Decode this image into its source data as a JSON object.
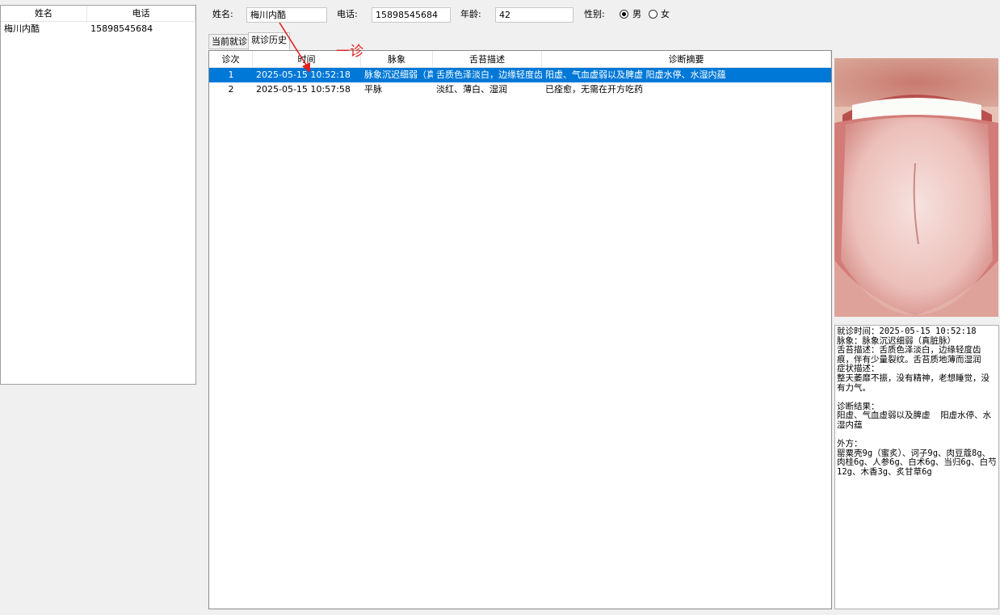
{
  "patient_list": {
    "headers": [
      "姓名",
      "电话"
    ],
    "rows": [
      {
        "name": "梅川内酷",
        "phone": "15898545684"
      }
    ]
  },
  "form": {
    "name_label": "姓名:",
    "name_value": "梅川内酷",
    "phone_label": "电话:",
    "phone_value": "15898545684",
    "age_label": "年龄:",
    "age_value": "42",
    "gender_label": "性别:",
    "gender_male": "男",
    "gender_female": "女",
    "gender_selected": "男"
  },
  "tabs": {
    "current": "当前就诊",
    "history": "就诊历史",
    "active": "history"
  },
  "grid": {
    "headers": [
      "诊次",
      "时间",
      "脉象",
      "舌苔描述",
      "诊断摘要"
    ],
    "rows": [
      {
        "no": "1",
        "time": "2025-05-15 10:52:18",
        "pulse": "脉象沉迟细弱（真",
        "tongue": "舌质色泽淡白，边缘轻度齿",
        "summary": "阳虚、气血虚弱以及脾虚  阳虚水停、水湿内蕴",
        "selected": true
      },
      {
        "no": "2",
        "time": "2025-05-15 10:57:58",
        "pulse": "平脉",
        "tongue": "淡红、薄白、湿润",
        "summary": "已痊愈，无需在开方吃药",
        "selected": false
      }
    ]
  },
  "annotation": {
    "text": "一诊",
    "color": "#e02020"
  },
  "notes": {
    "text": "就诊时间：2025-05-15 10:52:18\n脉象：脉象沉迟细弱（真脏脉）\n舌苔描述：舌质色泽淡白，边缘轻度齿痕，伴有少量裂纹。舌苔质地薄而湿润\n症状描述：\n整天萎靡不振，没有精神，老想睡觉，没有力气。\n\n诊断结果：\n阳虚、气血虚弱以及脾虚  阳虚水停、水湿内蕴\n\n外方：\n罂粟壳9g（蜜炙）、诃子9g、肉豆蔻8g、肉桂6g、人参6g、白术6g、当归6g、白芍12g、木香3g、炙甘草6g"
  },
  "colors": {
    "selection": "#0078d7",
    "window_bg": "#f0f0f0"
  }
}
